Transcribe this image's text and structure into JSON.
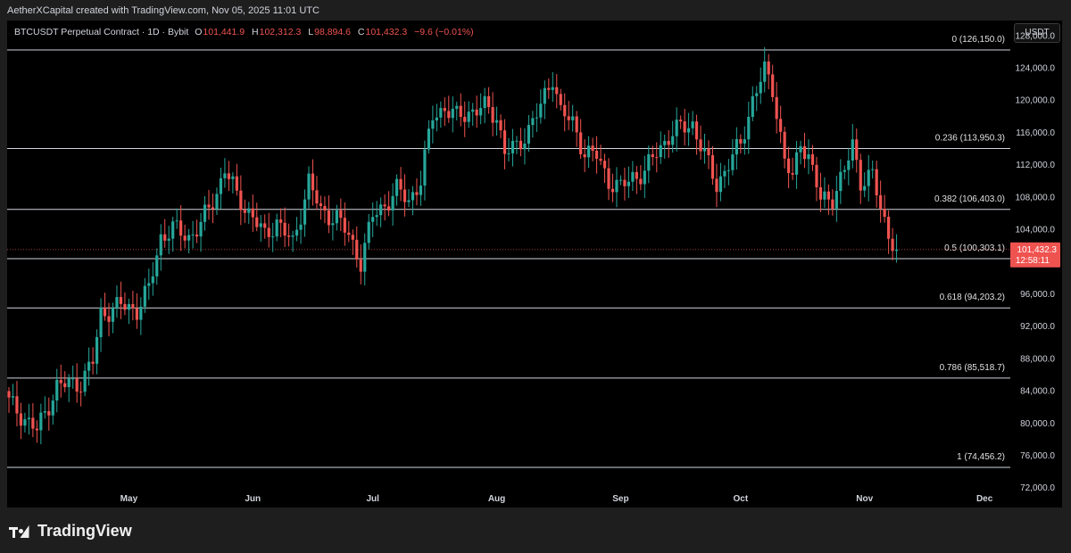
{
  "header": {
    "caption": "AetherXCapital created with TradingView.com, Nov 05, 2025 11:01 UTC"
  },
  "symbol_bar": {
    "name": "BTCUSDT Perpetual Contract · 1D · Bybit",
    "open_label": "O",
    "open": "101,441.9",
    "high_label": "H",
    "high": "102,312.3",
    "low_label": "L",
    "low": "98,894.6",
    "close_label": "C",
    "close": "101,432.3",
    "change": "−9.6 (−0.01%)"
  },
  "currency_button": "USDT",
  "price_badge": {
    "price": "101,432.3",
    "countdown": "12:58:11"
  },
  "brand": "TradingView",
  "colors": {
    "up": "#26a69a",
    "down": "#ef5350",
    "background": "#000000",
    "line": "#d1d4dc"
  },
  "chart_data": {
    "type": "candlestick",
    "title": "BTCUSDT Perpetual Contract · 1D · Bybit",
    "y_ticks": [
      "128,000.0",
      "124,000.0",
      "120,000.0",
      "116,000.0",
      "112,000.0",
      "108,000.0",
      "104,000.0",
      "96,000.0",
      "92,000.0",
      "88,000.0",
      "84,000.0",
      "80,000.0",
      "76,000.0",
      "72,000.0"
    ],
    "y_tick_values": [
      128000,
      124000,
      120000,
      116000,
      112000,
      108000,
      104000,
      96000,
      92000,
      88000,
      84000,
      80000,
      76000,
      72000
    ],
    "ylim": [
      71800,
      129800
    ],
    "x_ticks": [
      {
        "label": "May",
        "day": 30
      },
      {
        "label": "Jun",
        "day": 61
      },
      {
        "label": "Jul",
        "day": 91
      },
      {
        "label": "Aug",
        "day": 122
      },
      {
        "label": "Sep",
        "day": 153
      },
      {
        "label": "Oct",
        "day": 183
      },
      {
        "label": "Nov",
        "day": 214
      },
      {
        "label": "Dec",
        "day": 244
      }
    ],
    "fib_levels": [
      {
        "label": "0 (126,150.0)",
        "value": 126150
      },
      {
        "label": "0.236 (113,950.3)",
        "value": 113950.3
      },
      {
        "label": "0.382 (106,403.0)",
        "value": 106403
      },
      {
        "label": "0.5 (100,303.1)",
        "value": 100303.1
      },
      {
        "label": "0.618 (94,203.2)",
        "value": 94203.2
      },
      {
        "label": "0.786 (85,518.7)",
        "value": 85518.7
      },
      {
        "label": "1 (74,456.2)",
        "value": 74456.2
      }
    ],
    "last_price": 101432.3,
    "close_series": [
      {
        "day": 0,
        "close": 82500
      },
      {
        "day": 7,
        "close": 79000
      },
      {
        "day": 12,
        "close": 84500
      },
      {
        "day": 18,
        "close": 85000
      },
      {
        "day": 21,
        "close": 87500
      },
      {
        "day": 23,
        "close": 93500
      },
      {
        "day": 28,
        "close": 94500
      },
      {
        "day": 32,
        "close": 94000
      },
      {
        "day": 35,
        "close": 96500
      },
      {
        "day": 38,
        "close": 103000
      },
      {
        "day": 41,
        "close": 104000
      },
      {
        "day": 45,
        "close": 103000
      },
      {
        "day": 48,
        "close": 104500
      },
      {
        "day": 52,
        "close": 108500
      },
      {
        "day": 54,
        "close": 111500
      },
      {
        "day": 57,
        "close": 108000
      },
      {
        "day": 61,
        "close": 105500
      },
      {
        "day": 64,
        "close": 103000
      },
      {
        "day": 67,
        "close": 105000
      },
      {
        "day": 71,
        "close": 102000
      },
      {
        "day": 75,
        "close": 110000
      },
      {
        "day": 78,
        "close": 106000
      },
      {
        "day": 82,
        "close": 105500
      },
      {
        "day": 85,
        "close": 103000
      },
      {
        "day": 88,
        "close": 100000
      },
      {
        "day": 91,
        "close": 105500
      },
      {
        "day": 94,
        "close": 107000
      },
      {
        "day": 97,
        "close": 108800
      },
      {
        "day": 100,
        "close": 107500
      },
      {
        "day": 103,
        "close": 110000
      },
      {
        "day": 106,
        "close": 118000
      },
      {
        "day": 109,
        "close": 119000
      },
      {
        "day": 112,
        "close": 117800
      },
      {
        "day": 115,
        "close": 118500
      },
      {
        "day": 119,
        "close": 119000
      },
      {
        "day": 122,
        "close": 118000
      },
      {
        "day": 124,
        "close": 113500
      },
      {
        "day": 127,
        "close": 114000
      },
      {
        "day": 130,
        "close": 116500
      },
      {
        "day": 133,
        "close": 119000
      },
      {
        "day": 136,
        "close": 123000
      },
      {
        "day": 138,
        "close": 118500
      },
      {
        "day": 141,
        "close": 117000
      },
      {
        "day": 144,
        "close": 113500
      },
      {
        "day": 147,
        "close": 113000
      },
      {
        "day": 150,
        "close": 110000
      },
      {
        "day": 153,
        "close": 109000
      },
      {
        "day": 156,
        "close": 110500
      },
      {
        "day": 159,
        "close": 111000
      },
      {
        "day": 162,
        "close": 113500
      },
      {
        "day": 165,
        "close": 115500
      },
      {
        "day": 168,
        "close": 116500
      },
      {
        "day": 171,
        "close": 117000
      },
      {
        "day": 174,
        "close": 113000
      },
      {
        "day": 177,
        "close": 109500
      },
      {
        "day": 180,
        "close": 112000
      },
      {
        "day": 183,
        "close": 114500
      },
      {
        "day": 186,
        "close": 120000
      },
      {
        "day": 189,
        "close": 123500
      },
      {
        "day": 191,
        "close": 121500
      },
      {
        "day": 194,
        "close": 112500
      },
      {
        "day": 196,
        "close": 110000
      },
      {
        "day": 198,
        "close": 115000
      },
      {
        "day": 200,
        "close": 113000
      },
      {
        "day": 203,
        "close": 107500
      },
      {
        "day": 206,
        "close": 108000
      },
      {
        "day": 209,
        "close": 111000
      },
      {
        "day": 211,
        "close": 114500
      },
      {
        "day": 213,
        "close": 110000
      },
      {
        "day": 216,
        "close": 110500
      },
      {
        "day": 218,
        "close": 106500
      },
      {
        "day": 220,
        "close": 103500
      },
      {
        "day": 222,
        "close": 101432
      }
    ]
  }
}
